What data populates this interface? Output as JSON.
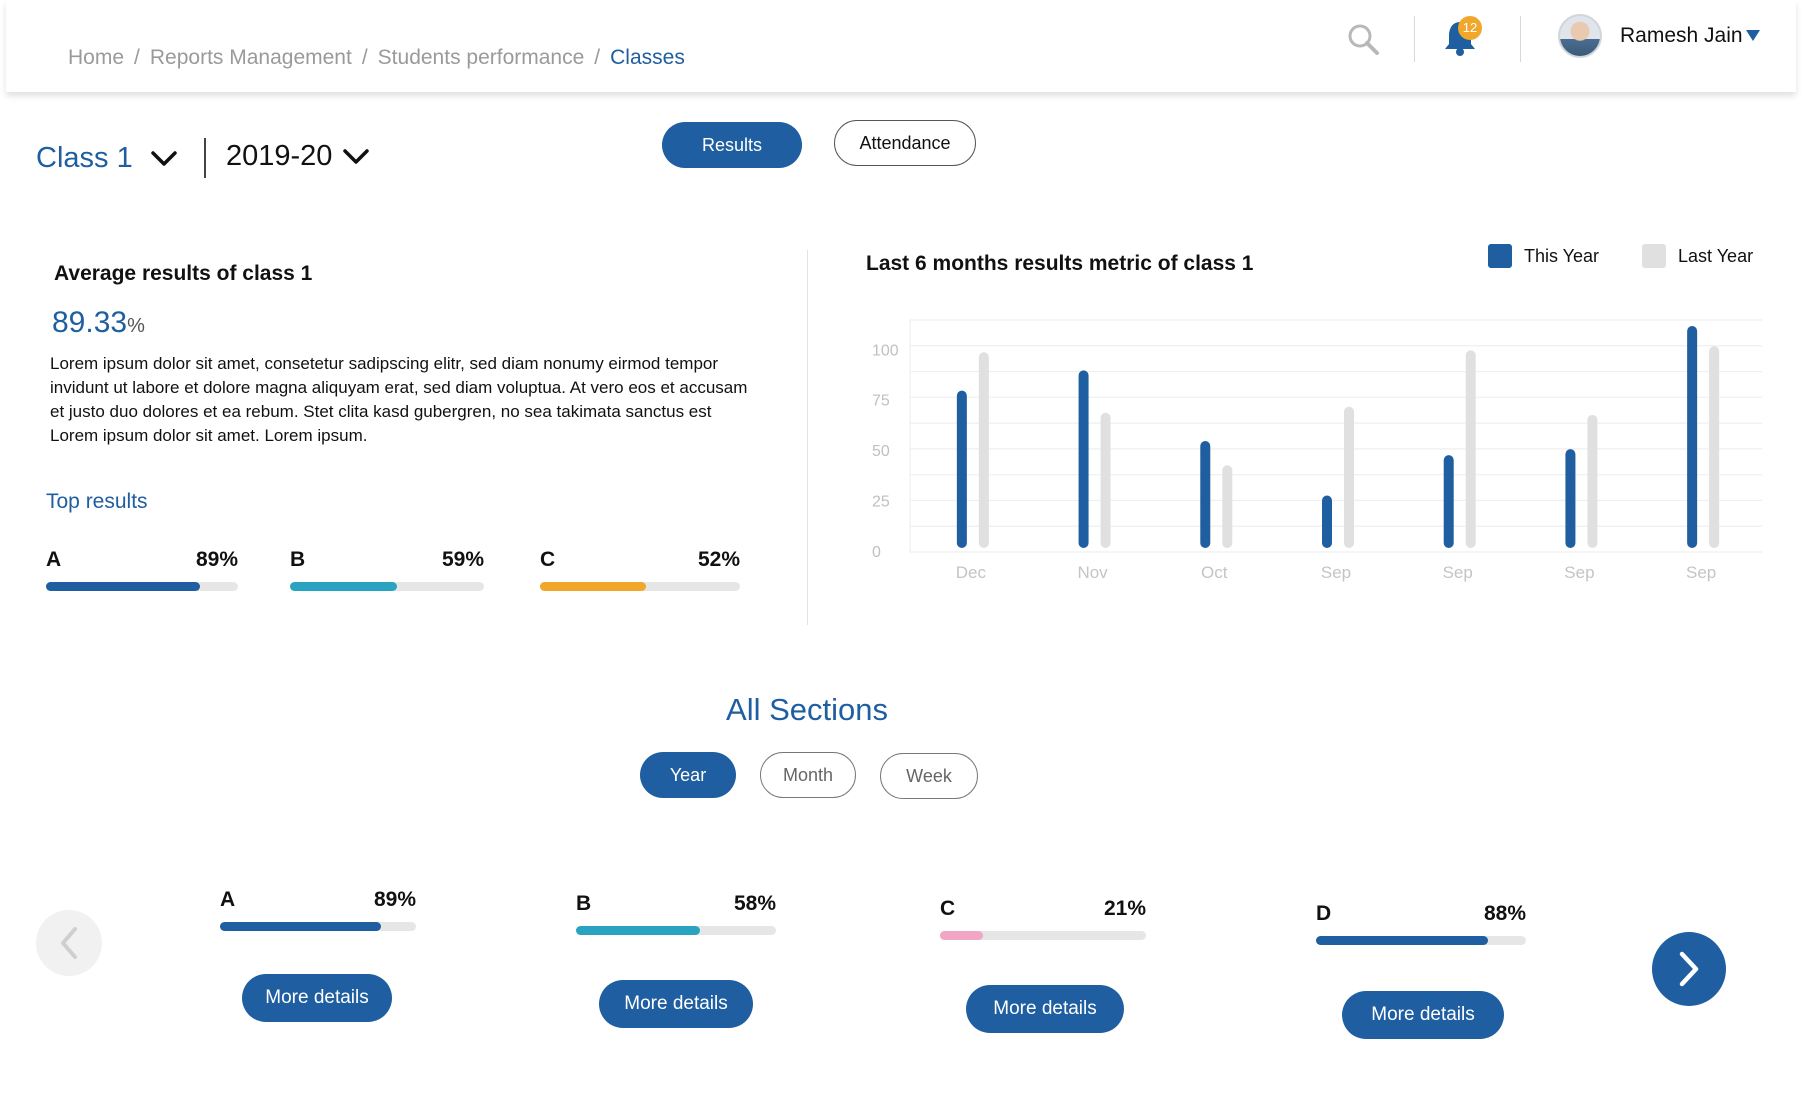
{
  "breadcrumb": [
    "Home",
    "Reports Management",
    "Students performance",
    "Classes"
  ],
  "header": {
    "notification_count": "12",
    "user_name": "Ramesh Jain"
  },
  "selectors": {
    "class": "Class 1",
    "year": "2019-20"
  },
  "view_toggle": {
    "results": "Results",
    "attendance": "Attendance",
    "active": "Results"
  },
  "summary": {
    "title": "Average results of class 1",
    "value": "89.33",
    "unit": "%",
    "description": "Lorem ipsum dolor sit amet, consetetur sadipscing elitr, sed diam nonumy eirmod tempor invidunt ut labore et dolore magna aliquyam erat, sed diam voluptua. At vero eos et accusam et justo duo dolores et ea rebum. Stet clita kasd gubergren, no sea takimata sanctus est Lorem ipsum dolor sit amet. Lorem ipsum."
  },
  "top_results": {
    "title": "Top results",
    "items": [
      {
        "label": "A",
        "value": "89%",
        "fraction": 0.8,
        "color": "#1f5ea0"
      },
      {
        "label": "B",
        "value": "59%",
        "fraction": 0.55,
        "color": "#2aa3c0"
      },
      {
        "label": "C",
        "value": "52%",
        "fraction": 0.53,
        "color": "#f0a72a"
      }
    ]
  },
  "chart_data": {
    "type": "bar",
    "title": "Last 6 months results metric of class 1",
    "categories": [
      "Dec",
      "Nov",
      "Oct",
      "Sep",
      "Sep",
      "Sep",
      "Sep"
    ],
    "series": [
      {
        "name": "This Year",
        "color": "#1f5ea0",
        "values": [
          80,
          90,
          55,
          28,
          48,
          51,
          112
        ]
      },
      {
        "name": "Last Year",
        "color": "#e0e0e0",
        "values": [
          99,
          69,
          43,
          72,
          100,
          68,
          102
        ]
      }
    ],
    "yticks": [
      0,
      25,
      50,
      75,
      100
    ],
    "ylim": [
      0,
      115
    ],
    "grid": true,
    "legend": "top-right"
  },
  "sections": {
    "title": "All Sections",
    "filters": [
      "Year",
      "Month",
      "Week"
    ],
    "active_filter": "Year",
    "items": [
      {
        "label": "A",
        "value": "89%",
        "fraction": 0.82,
        "color": "#1f5ea0",
        "button": "More details"
      },
      {
        "label": "B",
        "value": "58%",
        "fraction": 0.62,
        "color": "#2aa3c0",
        "button": "More details"
      },
      {
        "label": "C",
        "value": "21%",
        "fraction": 0.21,
        "color": "#f0a6c4",
        "button": "More details"
      },
      {
        "label": "D",
        "value": "88%",
        "fraction": 0.82,
        "color": "#1f5ea0",
        "button": "More details"
      }
    ]
  }
}
